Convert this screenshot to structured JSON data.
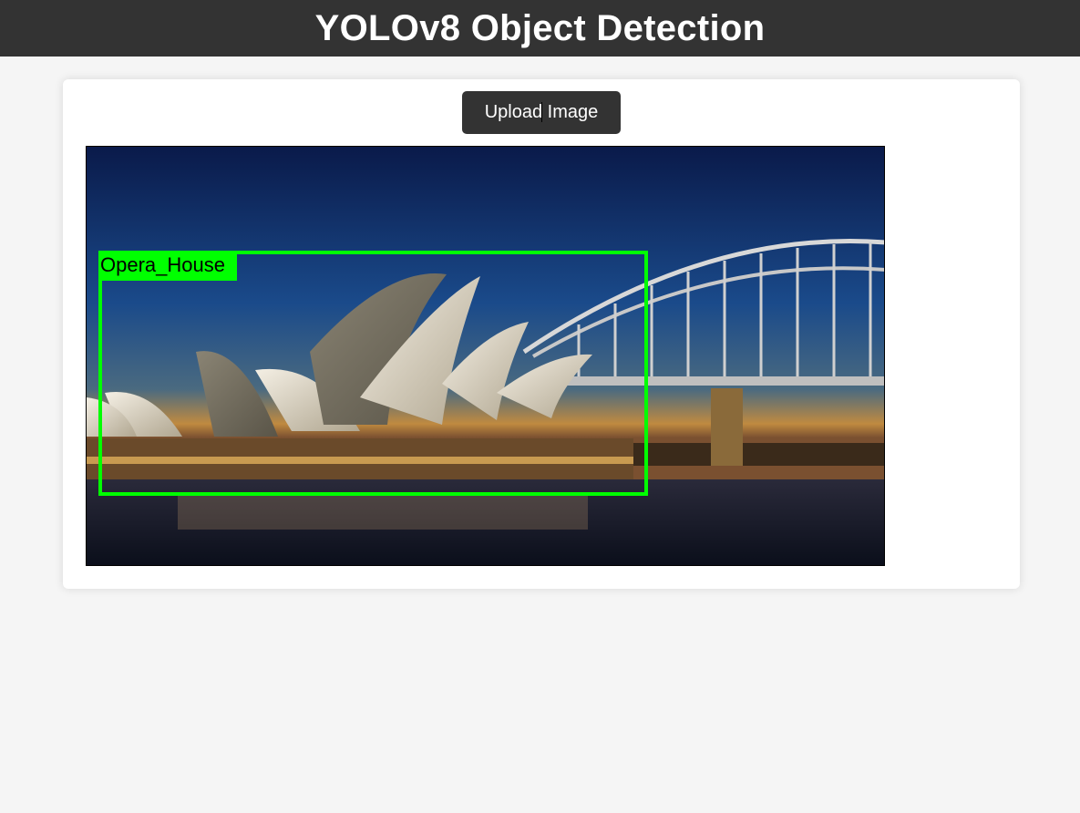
{
  "header": {
    "title": "YOLOv8 Object Detection"
  },
  "upload": {
    "button_label": "Upload Image"
  },
  "detection": {
    "label": "Opera_House",
    "box_color": "#00ff00"
  },
  "colors": {
    "header_bg": "#333333",
    "page_bg": "#f5f5f5",
    "button_bg": "#333333"
  }
}
